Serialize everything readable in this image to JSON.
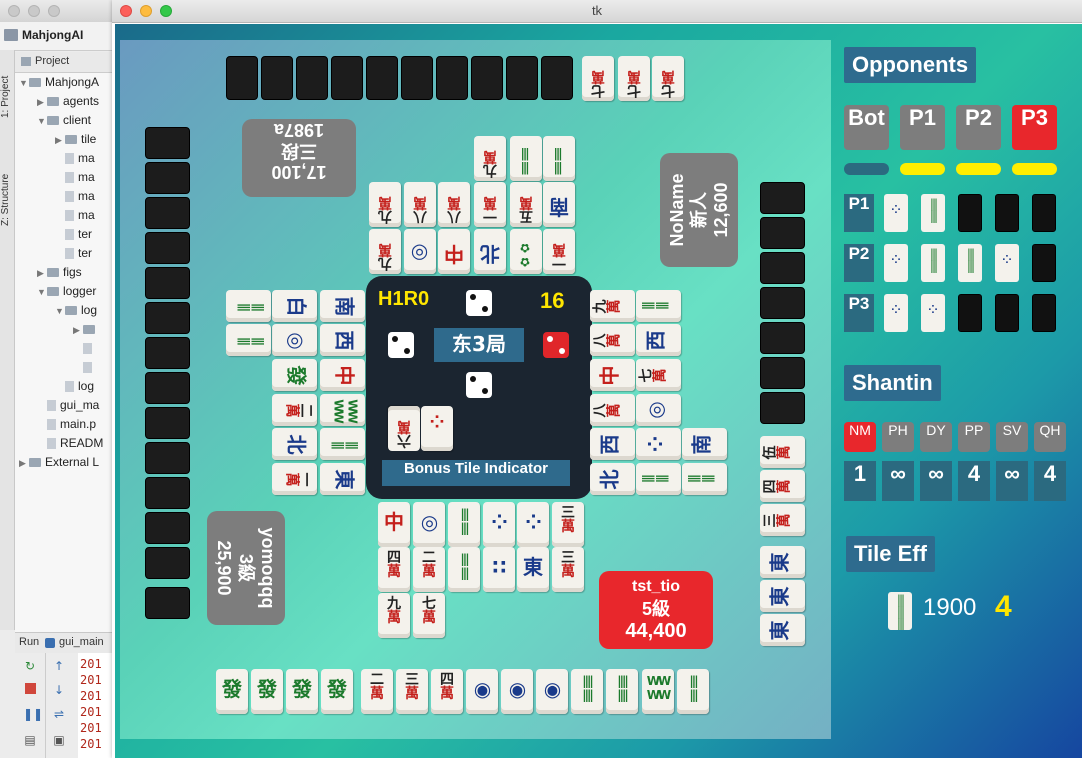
{
  "ide": {
    "project_name": "MahjongAI",
    "side_tabs": [
      "1: Project",
      "Z: Structure"
    ],
    "panel_title": "Project",
    "tree": [
      {
        "label": "MahjongA",
        "depth": 0,
        "type": "folder",
        "open": true
      },
      {
        "label": "agents",
        "depth": 1,
        "type": "folder",
        "open": false
      },
      {
        "label": "client",
        "depth": 1,
        "type": "folder",
        "open": true
      },
      {
        "label": "tile",
        "depth": 2,
        "type": "folder",
        "open": false
      },
      {
        "label": "ma",
        "depth": 2,
        "type": "file"
      },
      {
        "label": "ma",
        "depth": 2,
        "type": "file"
      },
      {
        "label": "ma",
        "depth": 2,
        "type": "file"
      },
      {
        "label": "ma",
        "depth": 2,
        "type": "file"
      },
      {
        "label": "ter",
        "depth": 2,
        "type": "file"
      },
      {
        "label": "ter",
        "depth": 2,
        "type": "file"
      },
      {
        "label": "figs",
        "depth": 1,
        "type": "folder",
        "open": false
      },
      {
        "label": "logger",
        "depth": 1,
        "type": "folder",
        "open": true
      },
      {
        "label": "log",
        "depth": 2,
        "type": "folder",
        "open": true
      },
      {
        "label": "",
        "depth": 3,
        "type": "folder",
        "open": false
      },
      {
        "label": "",
        "depth": 3,
        "type": "file"
      },
      {
        "label": "",
        "depth": 3,
        "type": "file"
      },
      {
        "label": "log",
        "depth": 2,
        "type": "file"
      },
      {
        "label": "gui_ma",
        "depth": 1,
        "type": "file"
      },
      {
        "label": "main.p",
        "depth": 1,
        "type": "file"
      },
      {
        "label": "READM",
        "depth": 1,
        "type": "file"
      },
      {
        "label": "External L",
        "depth": 0,
        "type": "lib",
        "open": false
      }
    ],
    "run_label": "Run",
    "run_config": "gui_main",
    "console_lines": [
      "201",
      "201",
      "201",
      "201",
      "201",
      "201"
    ]
  },
  "window": {
    "title": "tk"
  },
  "game": {
    "round_info": "H1R0",
    "tiles_remaining": "16",
    "round_wind": "东3局",
    "bonus_label": "Bonus Tile Indicator",
    "players": {
      "top": {
        "name": "1987a",
        "rank": "三段",
        "score": "17,100"
      },
      "right": {
        "name": "NoName",
        "rank": "新人",
        "score": "12,600"
      },
      "left": {
        "name": "yomoqqq",
        "rank": "3級",
        "score": "25,900"
      },
      "self": {
        "name": "tst_tio",
        "rank": "5級",
        "score": "44,400"
      }
    },
    "hand": [
      {
        "kind": "honor",
        "glyph": "發",
        "color": "green"
      },
      {
        "kind": "honor",
        "glyph": "發",
        "color": "green"
      },
      {
        "kind": "honor",
        "glyph": "發",
        "color": "green"
      },
      {
        "kind": "honor",
        "glyph": "發",
        "color": "green"
      },
      {
        "kind": "man",
        "num": "二",
        "glyph": "萬"
      },
      {
        "kind": "man",
        "num": "三",
        "glyph": "萬"
      },
      {
        "kind": "man",
        "num": "四",
        "glyph": "萬"
      },
      {
        "kind": "pin",
        "glyph": "◉"
      },
      {
        "kind": "pin",
        "glyph": "◉"
      },
      {
        "kind": "pin",
        "glyph": "◉"
      },
      {
        "kind": "sou",
        "glyph": "||||"
      },
      {
        "kind": "sou",
        "glyph": "||||"
      },
      {
        "kind": "sou",
        "glyph": "WW"
      },
      {
        "kind": "sou",
        "glyph": "|||"
      }
    ]
  },
  "panel": {
    "opponents_title": "Opponents",
    "opponent_buttons": [
      "Bot",
      "P1",
      "P2",
      "P3"
    ],
    "selected_opponent": "P3",
    "opp_rows": [
      "P1",
      "P2",
      "P3"
    ],
    "shanten_title": "Shantin",
    "shanten_labels": [
      "NM",
      "PH",
      "DY",
      "PP",
      "SV",
      "QH"
    ],
    "shanten_values": [
      "1",
      "∞",
      "∞",
      "4",
      "∞",
      "4"
    ],
    "tile_eff_title": "Tile Eff",
    "tile_eff_count": "1900",
    "tile_eff_value": "4",
    "colors": {
      "accent": "#2e6b8e",
      "selected": "#e8272c",
      "highlight": "#ffe600"
    }
  }
}
